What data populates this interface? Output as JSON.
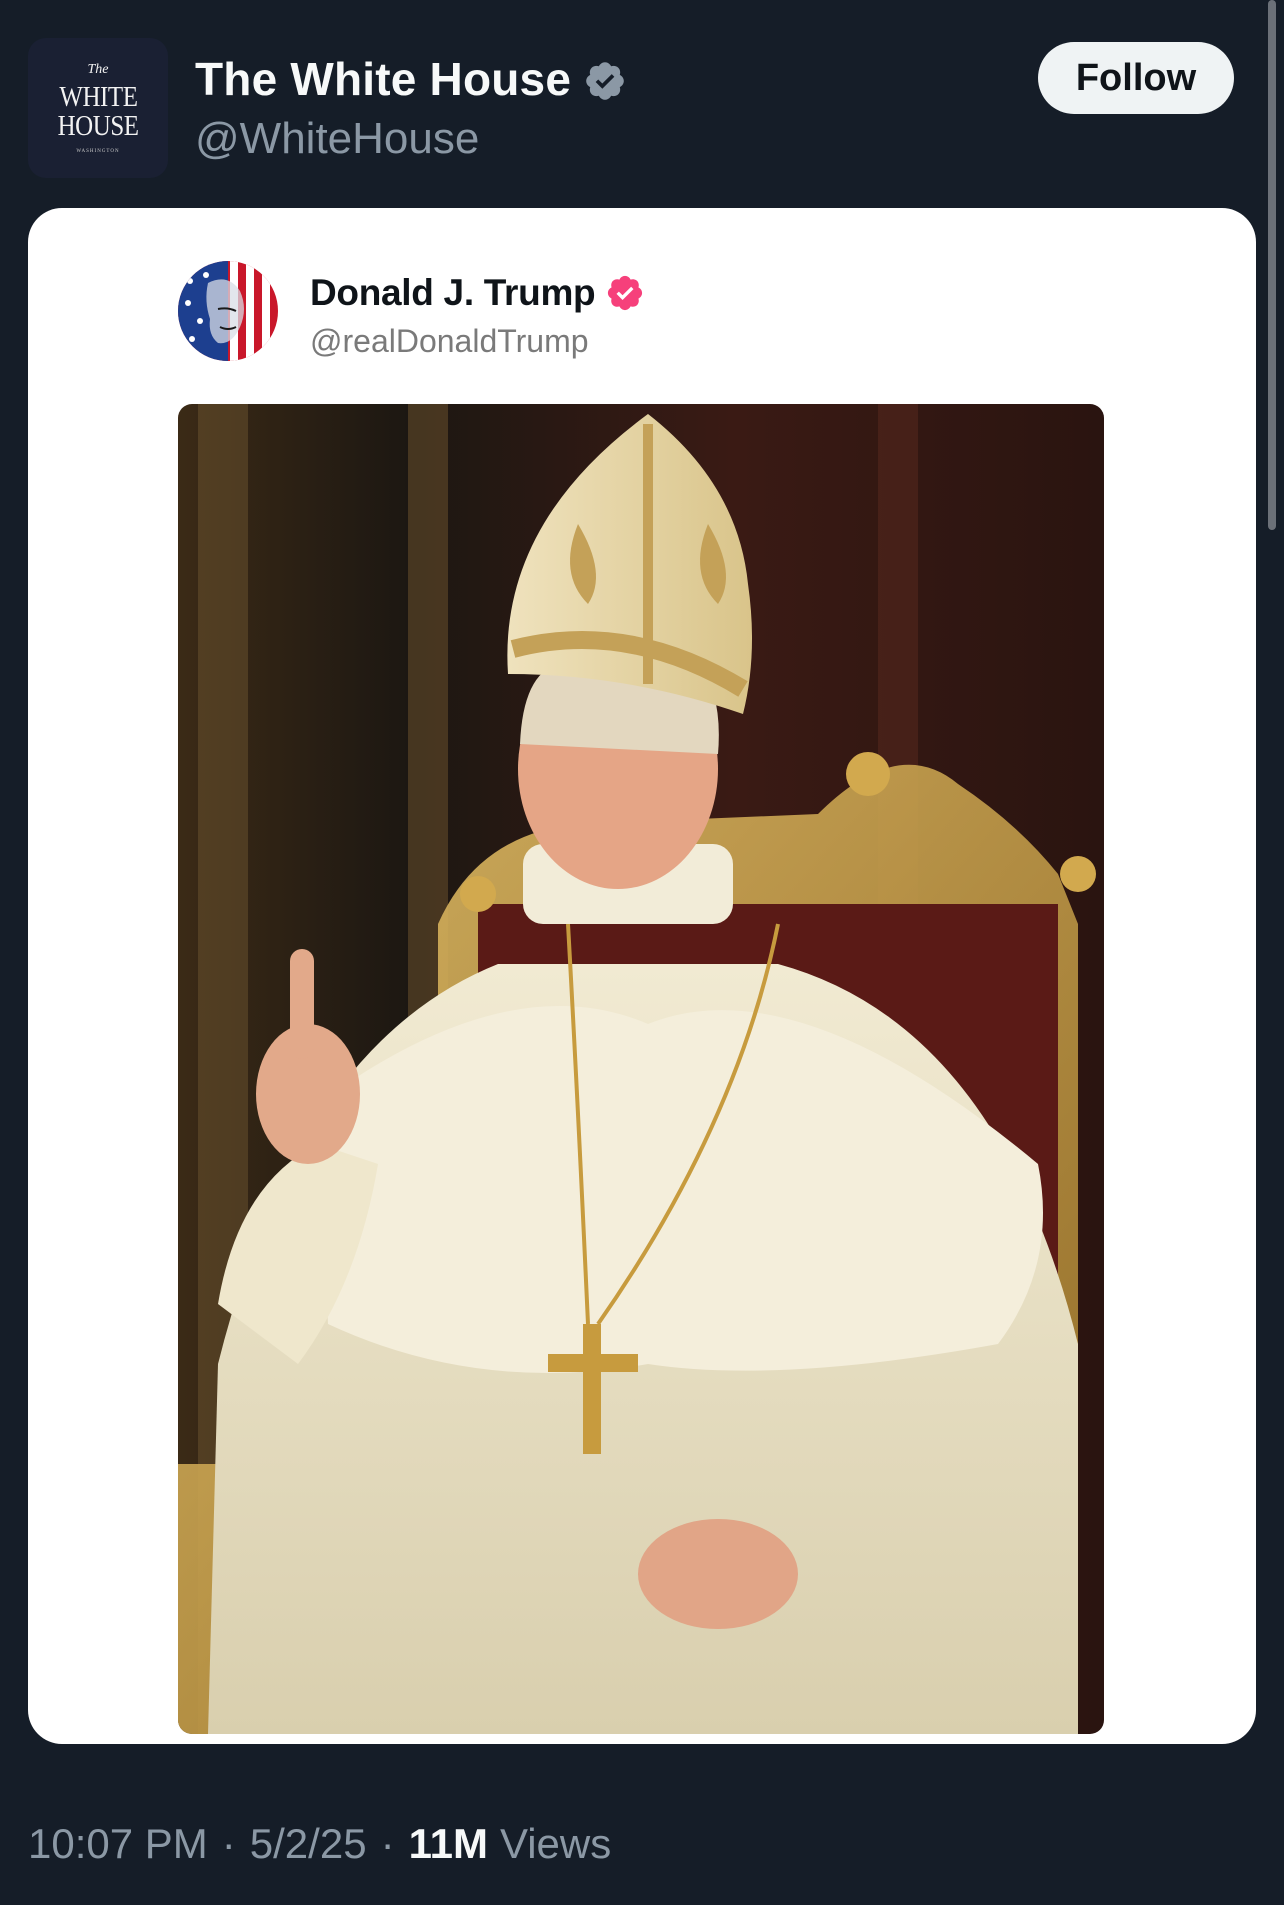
{
  "header": {
    "display_name": "The White House",
    "handle": "@WhiteHouse",
    "follow_label": "Follow",
    "avatar_logo": "The WHITE HOUSE WASHINGTON"
  },
  "embedded_post": {
    "display_name": "Donald J. Trump",
    "handle": "@realDonaldTrump",
    "verified_color": "#f6407b"
  },
  "meta": {
    "time": "10:07 PM",
    "separator": "·",
    "date": "5/2/25",
    "views_count": "11M",
    "views_label": "Views"
  },
  "colors": {
    "background": "#151d28",
    "card": "#ffffff",
    "muted_text": "#8b98a5",
    "verified_gray": "#8b98a5"
  },
  "icons": {
    "verified_badge": "verified-check-icon",
    "verified_badge_pink": "verified-check-icon"
  }
}
